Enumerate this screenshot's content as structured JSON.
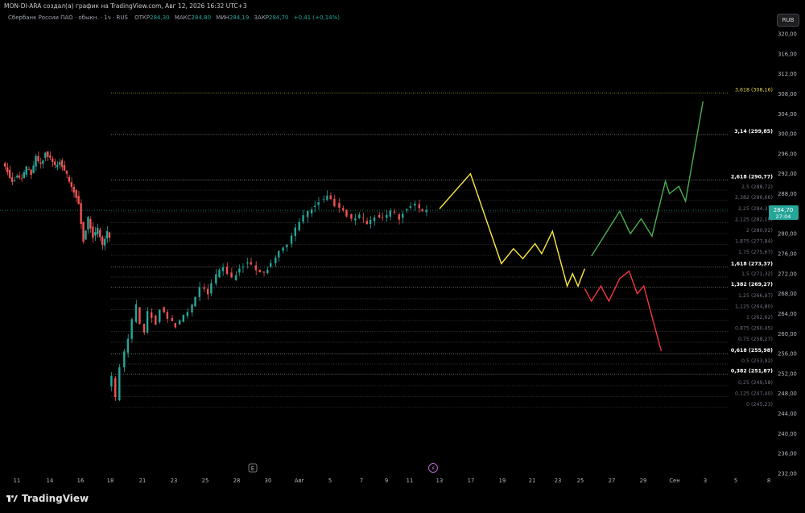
{
  "header": {
    "text": "MON-DI-ARA создал(а) график на TradingView.com, Авг 12, 2026 16:32 UTC+3"
  },
  "legend": {
    "symbol": "Сбербанк России ПАО · обыкн. · 1ч · RUS",
    "open_label": "ОТКР",
    "open_value": "284,30",
    "high_label": "МАКС",
    "high_value": "284,80",
    "low_label": "МИН",
    "low_value": "284,19",
    "close_label": "ЗАКР",
    "close_value": "284,70",
    "change": "+0,41 (+0,14%)"
  },
  "currency_button": "RUB",
  "price_tag": {
    "price": "284,70",
    "countdown": "27:04"
  },
  "time_marker_labels": [
    "E",
    "⚡"
  ],
  "logo_text": "TradingView",
  "colors": {
    "background": "#000000",
    "up": "#26a69a",
    "down": "#ef5350",
    "projection_yellow": "#ffeb3b",
    "projection_green": "#4caf50",
    "projection_red": "#f23645",
    "fib_key": "#ffffff",
    "fib_extension_top": "#e6d34a"
  },
  "chart_data": {
    "type": "candlestick",
    "y_axis": {
      "labels": [
        "320,00",
        "316,00",
        "312,00",
        "308,00",
        "304,00",
        "300,00",
        "296,00",
        "292,00",
        "288,00",
        "284,00",
        "280,00",
        "276,00",
        "272,00",
        "268,00",
        "264,00",
        "260,00",
        "256,00",
        "252,00",
        "248,00",
        "244,00",
        "240,00",
        "236,00",
        "232,00"
      ],
      "range": [
        230.5,
        322.0
      ]
    },
    "x_axis": {
      "labels": [
        "11",
        "14",
        "16",
        "18",
        "21",
        "23",
        "25",
        "28",
        "30",
        "Авг",
        "5",
        "7",
        "9",
        "11",
        "13",
        "17",
        "19",
        "21",
        "23",
        "25",
        "27",
        "29",
        "Сен",
        "3",
        "5",
        "8"
      ]
    },
    "fib_levels": [
      {
        "label": "3,618 (308,16)",
        "price": 308.16,
        "style": "highlight"
      },
      {
        "label": "3,14 (299,85)",
        "price": 299.85,
        "style": "key"
      },
      {
        "label": "2,618 (290,77)",
        "price": 290.77,
        "style": "key"
      },
      {
        "label": "2,5 (288,72)",
        "price": 288.72,
        "style": "minor"
      },
      {
        "label": "2,382 (286,66)",
        "price": 286.66,
        "style": "minor"
      },
      {
        "label": "2,25 (284,37)",
        "price": 284.37,
        "style": "minor"
      },
      {
        "label": "2,125 (282,19)",
        "price": 282.19,
        "style": "minor"
      },
      {
        "label": "2 (280,02)",
        "price": 280.02,
        "style": "minor"
      },
      {
        "label": "1,875 (277,84)",
        "price": 277.84,
        "style": "minor"
      },
      {
        "label": "1,75 (275,67)",
        "price": 275.67,
        "style": "minor"
      },
      {
        "label": "1,618 (273,37)",
        "price": 273.37,
        "style": "key"
      },
      {
        "label": "1,5 (271,32)",
        "price": 271.32,
        "style": "minor"
      },
      {
        "label": "1,382 (269,27)",
        "price": 269.27,
        "style": "key"
      },
      {
        "label": "1,25 (266,97)",
        "price": 266.97,
        "style": "minor"
      },
      {
        "label": "1,125 (264,80)",
        "price": 264.8,
        "style": "minor"
      },
      {
        "label": "1 (262,62)",
        "price": 262.62,
        "style": "minor"
      },
      {
        "label": "0,875 (260,45)",
        "price": 260.45,
        "style": "minor"
      },
      {
        "label": "0,75 (258,27)",
        "price": 258.27,
        "style": "minor"
      },
      {
        "label": "0,618 (255,98)",
        "price": 255.98,
        "style": "key"
      },
      {
        "label": "0,5 (253,92)",
        "price": 253.92,
        "style": "minor"
      },
      {
        "label": "0,382 (251,87)",
        "price": 251.87,
        "style": "key"
      },
      {
        "label": "0,25 (249,58)",
        "price": 249.58,
        "style": "minor"
      },
      {
        "label": "0,125 (247,40)",
        "price": 247.4,
        "style": "minor"
      },
      {
        "label": "0 (245,23)",
        "price": 245.23,
        "style": "minor"
      }
    ],
    "price_path": [
      [
        0,
        294.0
      ],
      [
        2,
        292.5
      ],
      [
        4,
        290.5
      ],
      [
        6,
        291.5
      ],
      [
        8,
        290.8
      ],
      [
        10,
        293.2
      ],
      [
        12,
        292.0
      ],
      [
        14,
        295.2
      ],
      [
        16,
        293.8
      ],
      [
        18,
        296.2
      ],
      [
        20,
        295.0
      ],
      [
        22,
        293.5
      ],
      [
        24,
        294.5
      ],
      [
        26,
        292.8
      ],
      [
        28,
        290.5
      ],
      [
        30,
        288.5
      ],
      [
        32,
        286.2
      ],
      [
        33,
        282.0
      ],
      [
        34,
        278.5
      ],
      [
        36,
        283.0
      ],
      [
        38,
        279.5
      ],
      [
        40,
        281.0
      ],
      [
        42,
        277.5
      ],
      [
        44,
        280.5
      ],
      [
        45,
        279.5
      ],
      [
        55,
        249.5
      ],
      [
        56,
        251.5
      ],
      [
        57,
        247.0
      ],
      [
        58,
        253.0
      ],
      [
        59,
        256.5
      ],
      [
        60,
        259.0
      ],
      [
        61,
        262.5
      ],
      [
        62,
        265.5
      ],
      [
        63,
        262.0
      ],
      [
        64,
        260.5
      ],
      [
        65,
        264.5
      ],
      [
        66,
        263.5
      ],
      [
        67,
        262.0
      ],
      [
        68,
        265.0
      ],
      [
        70,
        263.0
      ],
      [
        72,
        261.5
      ],
      [
        74,
        263.5
      ],
      [
        76,
        265.5
      ],
      [
        78,
        269.5
      ],
      [
        80,
        268.0
      ],
      [
        82,
        271.5
      ],
      [
        84,
        273.5
      ],
      [
        86,
        271.0
      ],
      [
        88,
        273.0
      ],
      [
        90,
        274.5
      ],
      [
        92,
        272.5
      ],
      [
        94,
        272.0
      ],
      [
        96,
        274.0
      ],
      [
        98,
        276.5
      ],
      [
        100,
        278.0
      ],
      [
        102,
        281.0
      ],
      [
        104,
        283.5
      ],
      [
        106,
        285.0
      ],
      [
        108,
        286.5
      ],
      [
        110,
        287.5
      ],
      [
        112,
        285.8
      ],
      [
        114,
        284.5
      ],
      [
        116,
        283.0
      ],
      [
        118,
        283.5
      ],
      [
        120,
        282.3
      ],
      [
        122,
        283.4
      ],
      [
        124,
        283.0
      ],
      [
        126,
        284.5
      ],
      [
        128,
        283.2
      ],
      [
        130,
        285.3
      ],
      [
        132,
        286.0
      ],
      [
        134,
        284.5
      ],
      [
        135,
        284.7
      ]
    ],
    "projections": [
      {
        "color": "yellow",
        "points": [
          [
            13.2,
            285.0
          ],
          [
            15.5,
            292.0
          ],
          [
            17.8,
            274.0
          ],
          [
            18.7,
            277.0
          ],
          [
            19.4,
            275.0
          ],
          [
            20.3,
            278.0
          ],
          [
            20.8,
            276.0
          ],
          [
            21.6,
            280.5
          ],
          [
            22.7,
            269.5
          ],
          [
            23.1,
            272.0
          ],
          [
            23.5,
            269.5
          ],
          [
            24.0,
            273.0
          ]
        ]
      },
      {
        "color": "green",
        "points": [
          [
            24.5,
            275.5
          ],
          [
            26.6,
            284.5
          ],
          [
            27.4,
            280.0
          ],
          [
            28.2,
            283.0
          ],
          [
            29.0,
            279.5
          ],
          [
            30.0,
            290.5
          ],
          [
            30.3,
            288.0
          ],
          [
            31.0,
            289.5
          ],
          [
            31.5,
            286.5
          ],
          [
            32.8,
            306.5
          ]
        ]
      },
      {
        "color": "red",
        "points": [
          [
            24.0,
            269.0
          ],
          [
            24.5,
            266.5
          ],
          [
            25.2,
            269.5
          ],
          [
            25.8,
            266.5
          ],
          [
            26.6,
            271.0
          ],
          [
            27.3,
            272.5
          ],
          [
            27.9,
            268.0
          ],
          [
            28.4,
            269.5
          ],
          [
            29.7,
            256.5
          ]
        ]
      }
    ]
  }
}
